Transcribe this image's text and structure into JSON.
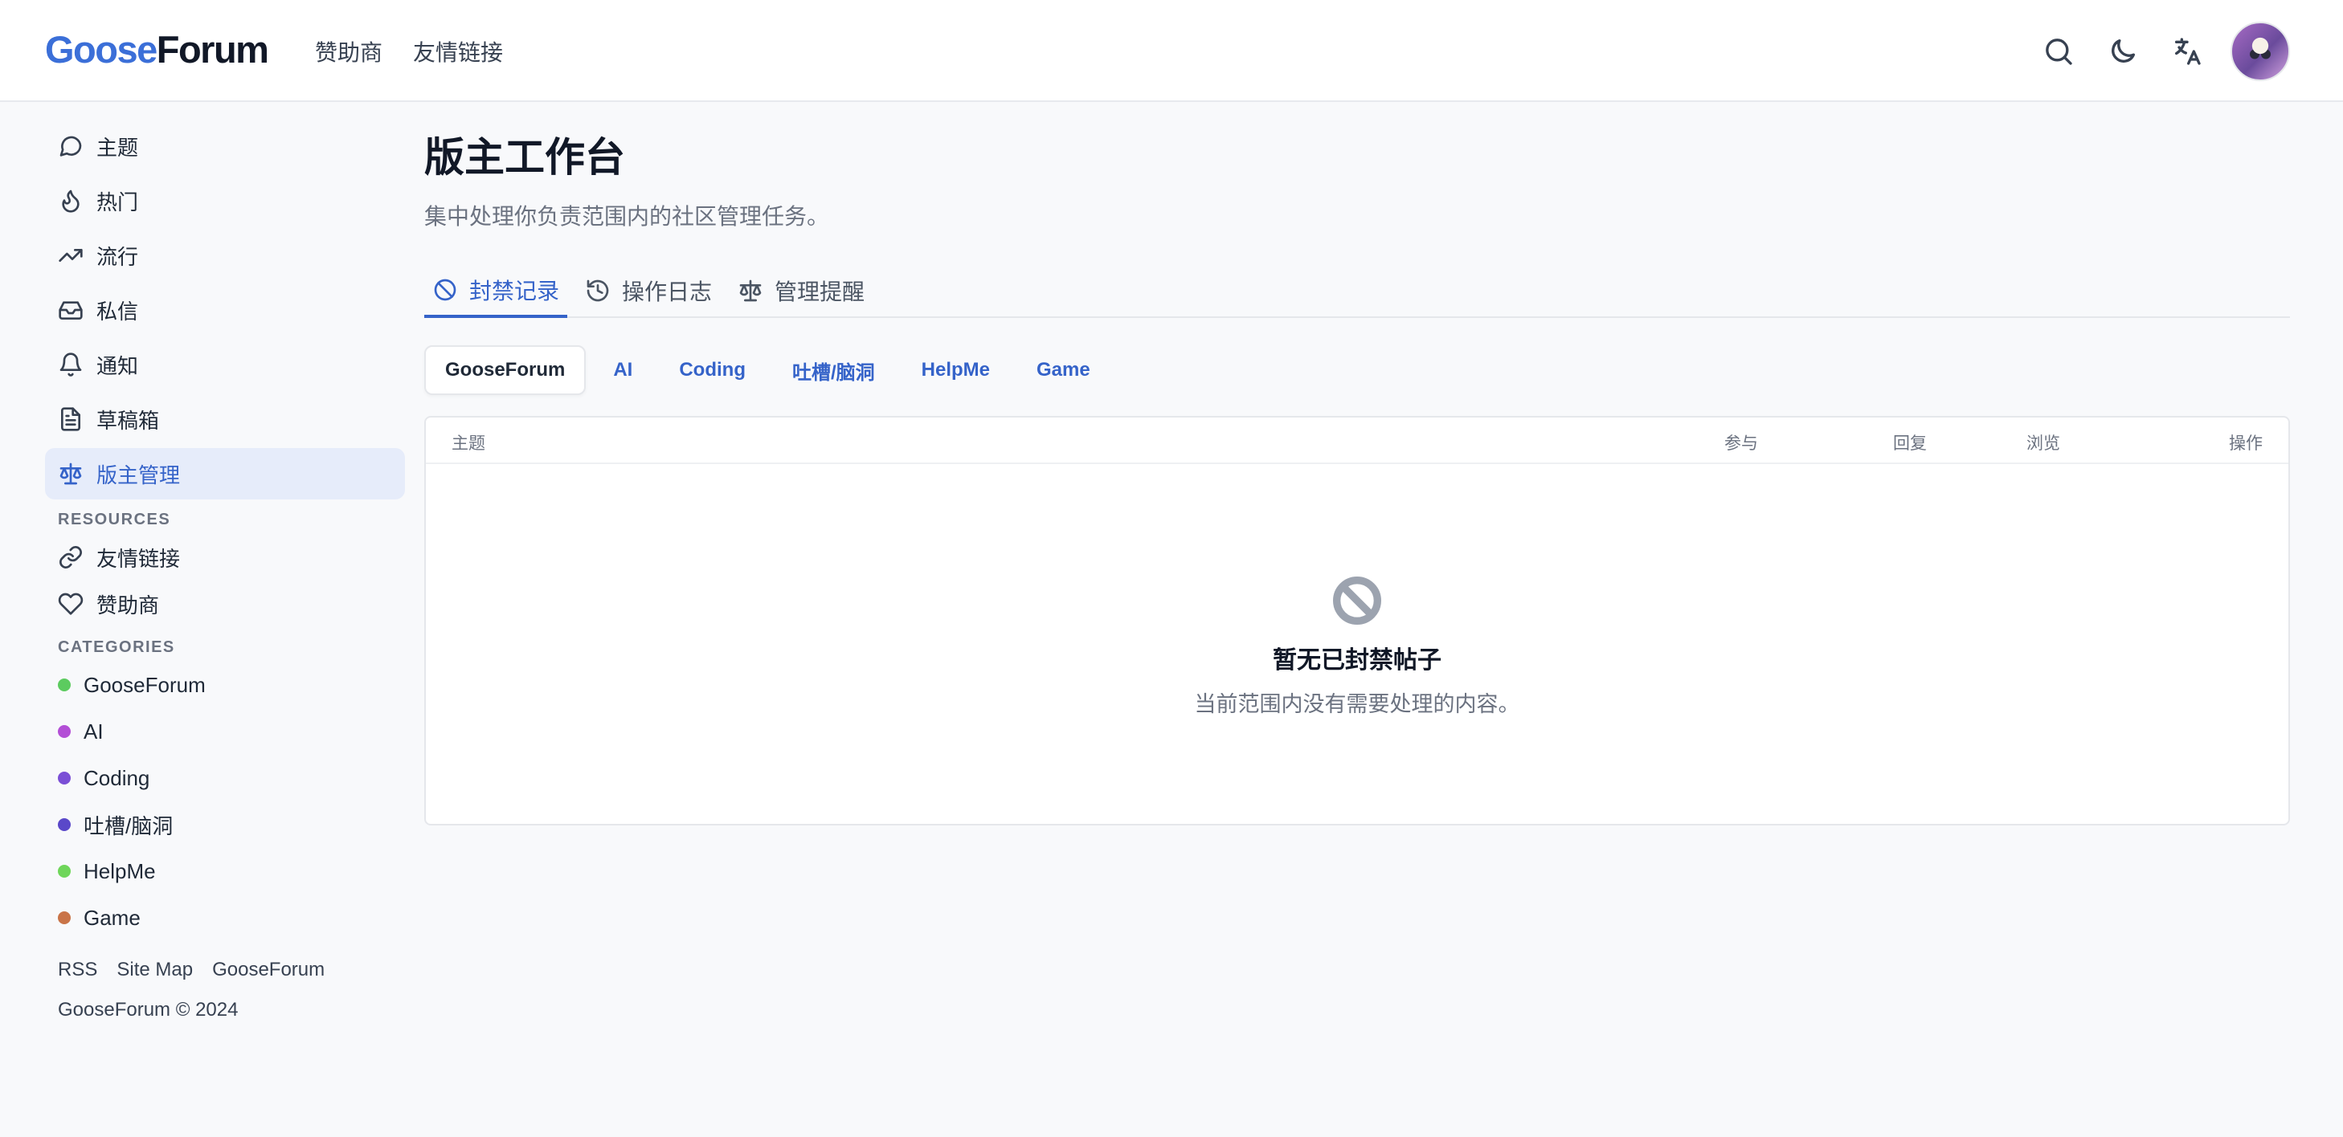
{
  "header": {
    "logo_part1": "Goose",
    "logo_part2": "Forum",
    "nav": [
      "赞助商",
      "友情链接"
    ],
    "icons": [
      "search-icon",
      "moon-icon",
      "translate-icon"
    ]
  },
  "sidebar": {
    "items": [
      {
        "label": "主题",
        "icon": "message-circle-icon"
      },
      {
        "label": "热门",
        "icon": "flame-icon"
      },
      {
        "label": "流行",
        "icon": "trending-up-icon"
      },
      {
        "label": "私信",
        "icon": "inbox-icon"
      },
      {
        "label": "通知",
        "icon": "bell-icon"
      },
      {
        "label": "草稿箱",
        "icon": "file-text-icon"
      },
      {
        "label": "版主管理",
        "icon": "scale-icon",
        "active": true
      }
    ],
    "resources_label": "RESOURCES",
    "resources": [
      {
        "label": "友情链接",
        "icon": "link-icon"
      },
      {
        "label": "赞助商",
        "icon": "heart-icon"
      }
    ],
    "categories_label": "CATEGORIES",
    "categories": [
      {
        "label": "GooseForum",
        "color": "#5ccb5f"
      },
      {
        "label": "AI",
        "color": "#b34fd6"
      },
      {
        "label": "Coding",
        "color": "#7b4fd6"
      },
      {
        "label": "吐槽/脑洞",
        "color": "#5a48c9"
      },
      {
        "label": "HelpMe",
        "color": "#6fd65a"
      },
      {
        "label": "Game",
        "color": "#c97448"
      }
    ],
    "footer_links": [
      "RSS",
      "Site Map",
      "GooseForum"
    ],
    "copyright": "GooseForum © 2024"
  },
  "main": {
    "title": "版主工作台",
    "subtitle": "集中处理你负责范围内的社区管理任务。",
    "tabs": [
      {
        "label": "封禁记录",
        "icon": "ban-icon",
        "active": true
      },
      {
        "label": "操作日志",
        "icon": "history-icon"
      },
      {
        "label": "管理提醒",
        "icon": "scale-icon"
      }
    ],
    "category_tabs": [
      "GooseForum",
      "AI",
      "Coding",
      "吐槽/脑洞",
      "HelpMe",
      "Game"
    ],
    "table": {
      "headers": [
        "主题",
        "参与",
        "回复",
        "浏览",
        "操作"
      ]
    },
    "empty": {
      "title": "暂无已封禁帖子",
      "description": "当前范围内没有需要处理的内容。"
    }
  }
}
